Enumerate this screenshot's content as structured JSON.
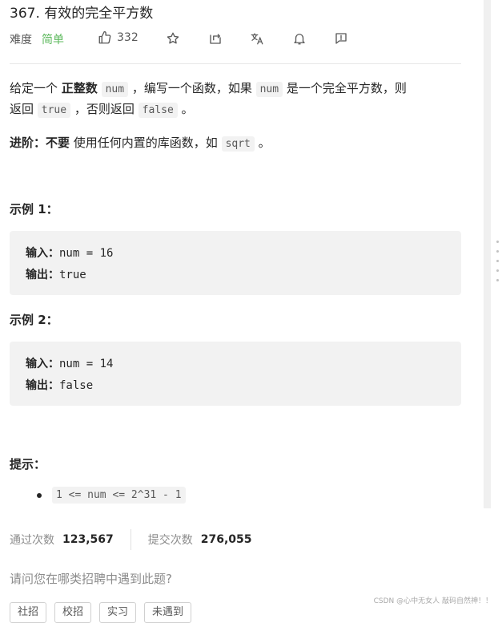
{
  "header": {
    "title": "367. 有效的完全平方数",
    "difficulty_label": "难度",
    "difficulty_value": "简单",
    "likes": "332"
  },
  "icons": {
    "like": "thumbs-up-icon",
    "star": "star-icon",
    "share": "share-icon",
    "translate": "translate-icon",
    "notify": "bell-icon",
    "feedback": "feedback-icon"
  },
  "description": {
    "line1": {
      "t1": "给定一个 ",
      "b1": "正整数",
      "c1": "num",
      "t2": " ，编写一个函数，如果 ",
      "c2": "num",
      "t3": " 是一个完全平方数，则"
    },
    "line2": {
      "t1": "返回 ",
      "c1": "true",
      "t2": " ，否则返回 ",
      "c2": "false",
      "t3": " 。"
    },
    "advanced": {
      "label": "进阶：",
      "strong": "不要",
      "t1": " 使用任何内置的库函数，如 ",
      "c1": "sqrt",
      "t2": " 。"
    }
  },
  "examples": [
    {
      "heading": "示例 1：",
      "input_label": "输入：",
      "input": "num = 16",
      "output_label": "输出：",
      "output": "true"
    },
    {
      "heading": "示例 2：",
      "input_label": "输入：",
      "input": "num = 14",
      "output_label": "输出：",
      "output": "false"
    }
  ],
  "hints": {
    "heading": "提示：",
    "items": [
      "1 <= num <= 2^31 - 1"
    ]
  },
  "stats": {
    "accepted_label": "通过次数",
    "accepted_value": "123,567",
    "submitted_label": "提交次数",
    "submitted_value": "276,055"
  },
  "question": "请问您在哪类招聘中遇到此题?",
  "tags": [
    "社招",
    "校招",
    "实习",
    "未遇到"
  ],
  "watermark": "CSDN @心中无女人 敲码自然神！！",
  "colors": {
    "easy": "#5cb85c",
    "code_bg": "#f2f2f2",
    "muted": "#8c8c8c"
  }
}
